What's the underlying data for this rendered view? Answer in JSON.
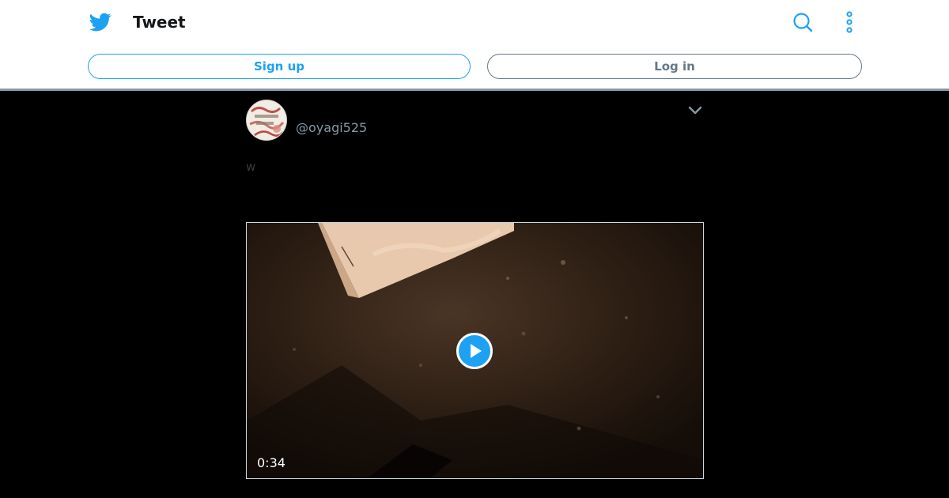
{
  "header": {
    "title": "Tweet",
    "signup_label": "Sign up",
    "login_label": "Log in",
    "icons": {
      "logo": "twitter-bird-icon",
      "search": "search-icon",
      "more": "more-vertical-icon"
    }
  },
  "tweet": {
    "handle": "@oyagi525",
    "text": "w",
    "video": {
      "duration": "0:34"
    }
  },
  "colors": {
    "brand": "#1da1f2",
    "page_background": "#000000",
    "header_background": "#ffffff",
    "secondary_text": "#8899a6",
    "login_border": "#657786"
  }
}
